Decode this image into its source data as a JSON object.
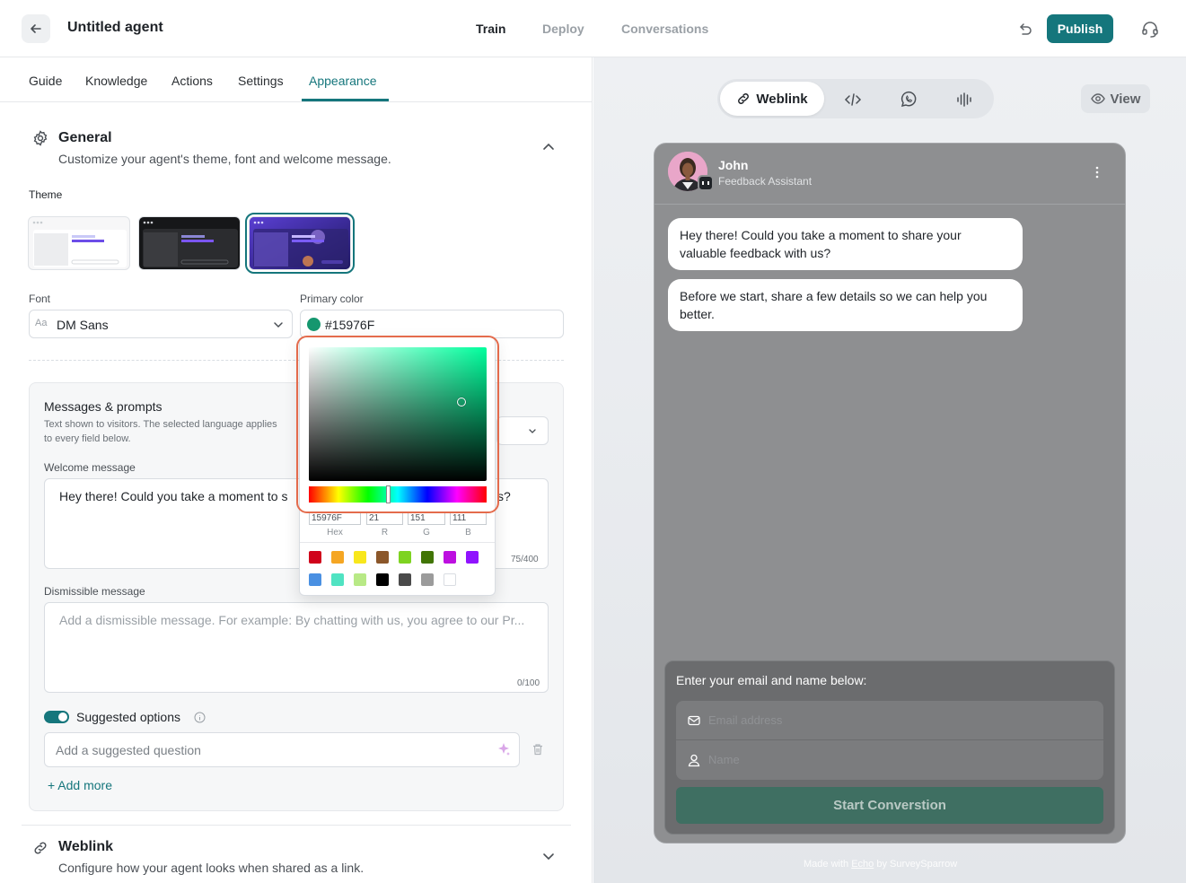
{
  "header": {
    "title": "Untitled agent",
    "nav": [
      "Train",
      "Deploy",
      "Conversations"
    ],
    "publish_label": "Publish"
  },
  "tabs": [
    "Guide",
    "Knowledge",
    "Actions",
    "Settings",
    "Appearance"
  ],
  "general": {
    "title": "General",
    "subtitle": "Customize your agent's theme, font and welcome message.",
    "theme_label": "Theme",
    "font_label": "Font",
    "font_value": "DM Sans",
    "font_prefix": "Aa",
    "primary_color_label": "Primary color",
    "primary_color_value": "#15976F",
    "primary_color": "#15976F"
  },
  "picker": {
    "fields": {
      "hex": "15976F",
      "r": "21",
      "g": "151",
      "b": "111"
    },
    "captions": {
      "hex": "Hex",
      "r": "R",
      "g": "G",
      "b": "B"
    },
    "swatches": [
      "#d0021b",
      "#f5a623",
      "#f8e71c",
      "#8b572a",
      "#7ed321",
      "#417505",
      "#bd10e0",
      "#9013fe",
      "#4a90e2",
      "#50e3c2",
      "#b8e986",
      "#000000",
      "#4a4a4a",
      "#9b9b9b",
      "#ffffff"
    ]
  },
  "messages": {
    "title": "Messages & prompts",
    "description": "Text shown to visitors. The selected language applies to every field below.",
    "welcome_label": "Welcome message",
    "welcome_text_left": "Hey there! Could you take a moment to s",
    "welcome_text_right": "s?",
    "welcome_counter": "75/400",
    "dismissible_label": "Dismissible message",
    "dismissible_placeholder": "Add a dismissible message. For example: By chatting with us, you agree to our Pr...",
    "dismissible_counter": "0/100",
    "suggested_label": "Suggested options",
    "suggested_placeholder": "Add a suggested question",
    "add_more": "Add more"
  },
  "weblink_section": {
    "title": "Weblink",
    "subtitle": "Configure how your agent looks when shared as a link."
  },
  "preview": {
    "channel_active": "Weblink",
    "view_label": "View",
    "bot_name": "John",
    "bot_role": "Feedback Assistant",
    "messages": [
      "Hey there! Could you take a moment to share your valuable feedback with us?",
      "Before we start, share a few details so we can help you better."
    ],
    "form_title": "Enter your email and name below:",
    "email_placeholder": "Email address",
    "name_placeholder": "Name",
    "start_label": "Start Converstion",
    "footer_prefix": "Made with ",
    "footer_link": "Echo",
    "footer_suffix": " by SurveySparrow"
  }
}
